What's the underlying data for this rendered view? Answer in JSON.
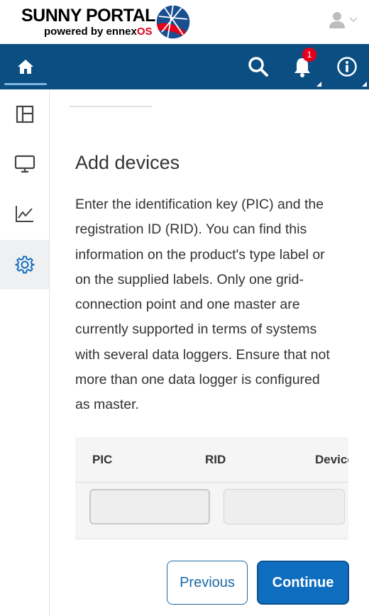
{
  "brand": {
    "title": "SUNNY PORTAL",
    "subtitle_prefix": "powered by ennex",
    "subtitle_suffix": "OS",
    "logo_icon": "globe-logo"
  },
  "header": {
    "user_icon": "user-icon",
    "user_menu_icon": "chevron-down-icon"
  },
  "nav": {
    "home_icon": "home-icon",
    "search_icon": "search-icon",
    "notifications_icon": "bell-icon",
    "notification_count": "1",
    "info_icon": "info-icon",
    "active_color": "#0a4e82"
  },
  "sidebar": {
    "items": [
      {
        "icon": "dashboard-icon",
        "active": false
      },
      {
        "icon": "monitor-icon",
        "active": false
      },
      {
        "icon": "analysis-chart-icon",
        "active": false
      },
      {
        "icon": "settings-gear-icon",
        "active": true
      }
    ]
  },
  "main": {
    "heading": "Add devices",
    "description": "Enter the identification key (PIC) and the registration ID (RID). You can find this information on the product's type label or on the supplied labels. Only one grid-connection point and one master are currently supported in terms of systems with several data loggers. Ensure that not more than one data logger is configured as master.",
    "table": {
      "columns": [
        "PIC",
        "RID",
        "Device"
      ],
      "row": {
        "pic_value": "",
        "rid_value": ""
      }
    },
    "buttons": {
      "previous": "Previous",
      "continue": "Continue"
    }
  }
}
